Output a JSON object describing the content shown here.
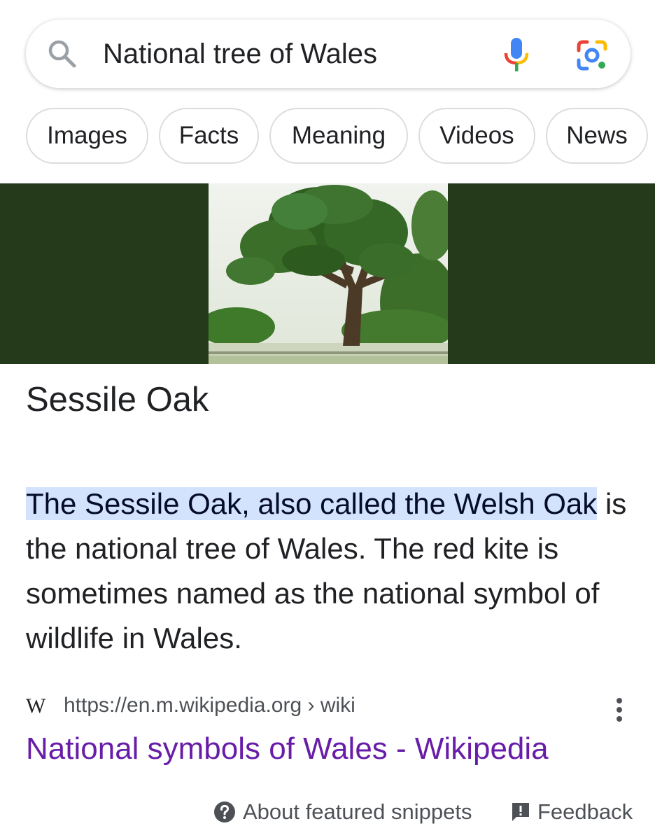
{
  "search": {
    "query": "National tree of Wales"
  },
  "chips": [
    "Images",
    "Facts",
    "Meaning",
    "Videos",
    "News"
  ],
  "answer": {
    "title": "Sessile Oak"
  },
  "snippet": {
    "highlight": "The Sessile Oak, also called the Welsh Oak",
    "rest": " is the national tree of Wales. The red kite is sometimes named as the national symbol of wildlife in Wales."
  },
  "source": {
    "logo": "W",
    "url": "https://en.m.wikipedia.org › wiki",
    "title": "National symbols of Wales - Wikipedia"
  },
  "footer": {
    "about": "About featured snippets",
    "feedback": "Feedback"
  },
  "colors": {
    "image_background": "#253a1b",
    "highlight": "#d3e3fd",
    "visited_link": "#681da8"
  }
}
